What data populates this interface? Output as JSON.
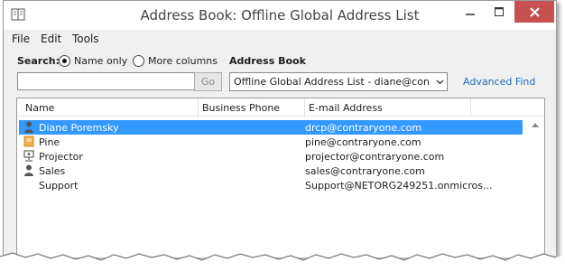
{
  "window": {
    "title": "Address Book: Offline Global Address List"
  },
  "menu": {
    "items": [
      "File",
      "Edit",
      "Tools"
    ]
  },
  "search": {
    "label": "Search:",
    "option_name_only": "Name only",
    "option_more_columns": "More columns",
    "selected": "name_only",
    "input_value": "",
    "go_label": "Go"
  },
  "address_book": {
    "label": "Address Book",
    "selected_value": "Offline Global Address List - diane@contra",
    "advanced_find": "Advanced Find"
  },
  "table": {
    "columns": [
      "Name",
      "Business Phone",
      "E-mail Address"
    ],
    "rows": [
      {
        "icon": "person-icon",
        "name": "Diane Poremsky",
        "phone": "",
        "email": "drcp@contraryone.com",
        "selected": true
      },
      {
        "icon": "room-icon",
        "name": "Pine",
        "phone": "",
        "email": "pine@contraryone.com",
        "selected": false
      },
      {
        "icon": "equipment-icon",
        "name": "Projector",
        "phone": "",
        "email": "projector@contraryone.com",
        "selected": false
      },
      {
        "icon": "person-icon",
        "name": "Sales",
        "phone": "",
        "email": "sales@contraryone.com",
        "selected": false
      },
      {
        "icon": "",
        "name": "Support",
        "phone": "",
        "email": "Support@NETORG249251.onmicros...",
        "selected": false
      }
    ]
  },
  "colors": {
    "selection": "#3399ff",
    "link": "#1e6bb8",
    "close_button": "#c75050",
    "person_icon": "#555555",
    "room_icon": "#f0b050"
  }
}
